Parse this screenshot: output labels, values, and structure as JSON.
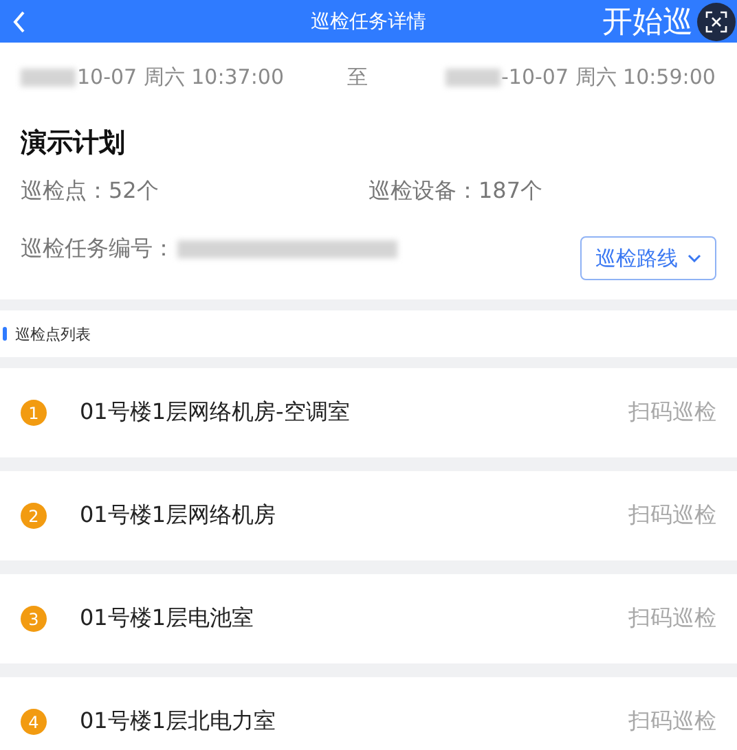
{
  "nav_bar": {
    "title": "巡检任务详情",
    "action": "开始巡"
  },
  "time_range": {
    "start": "10-07 周六 10:37:00",
    "separator": "至",
    "end": "-10-07 周六 10:59:00"
  },
  "plan": {
    "name": "演示计划",
    "points": "巡检点：52个",
    "devices": "巡检设备：187个",
    "task_number_label": "巡检任务编号：",
    "route_button": "巡检路线"
  },
  "section_title": "巡检点列表",
  "points": [
    {
      "index": "1",
      "name": "01号楼1层网络机房-空调室",
      "action": "扫码巡检"
    },
    {
      "index": "2",
      "name": "01号楼1层网络机房",
      "action": "扫码巡检"
    },
    {
      "index": "3",
      "name": "01号楼1层电池室",
      "action": "扫码巡检"
    },
    {
      "index": "4",
      "name": "01号楼1层北电力室",
      "action": "扫码巡检"
    }
  ]
}
